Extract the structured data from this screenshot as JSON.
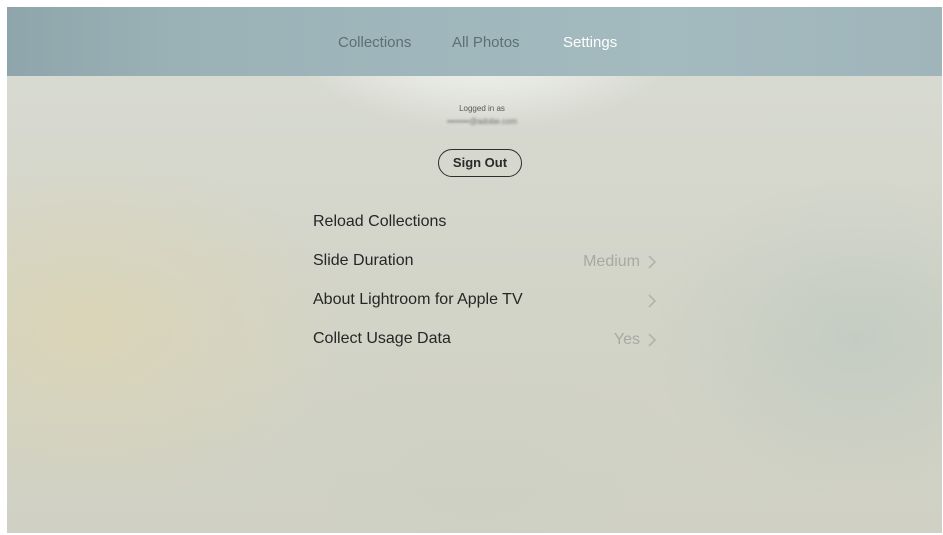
{
  "tabs": [
    {
      "label": "Collections",
      "active": false
    },
    {
      "label": "All Photos",
      "active": false
    },
    {
      "label": "Settings",
      "active": true
    }
  ],
  "account": {
    "logged_in_label": "Logged in as",
    "email_obscured": "••••••••@adobe.com",
    "sign_out_label": "Sign Out"
  },
  "settings": [
    {
      "label": "Reload Collections",
      "value": "",
      "has_chevron": false
    },
    {
      "label": "Slide Duration",
      "value": "Medium",
      "has_chevron": true
    },
    {
      "label": "About Lightroom for Apple TV",
      "value": "",
      "has_chevron": true
    },
    {
      "label": "Collect Usage Data",
      "value": "Yes",
      "has_chevron": true
    }
  ],
  "icons": {
    "disclosure": "chevron-right-icon"
  },
  "colors": {
    "tabbar": "#9fb7bc",
    "active_tab": "#ffffff",
    "inactive_tab": "#5d6f73",
    "value_text": "#a8a8a4"
  }
}
